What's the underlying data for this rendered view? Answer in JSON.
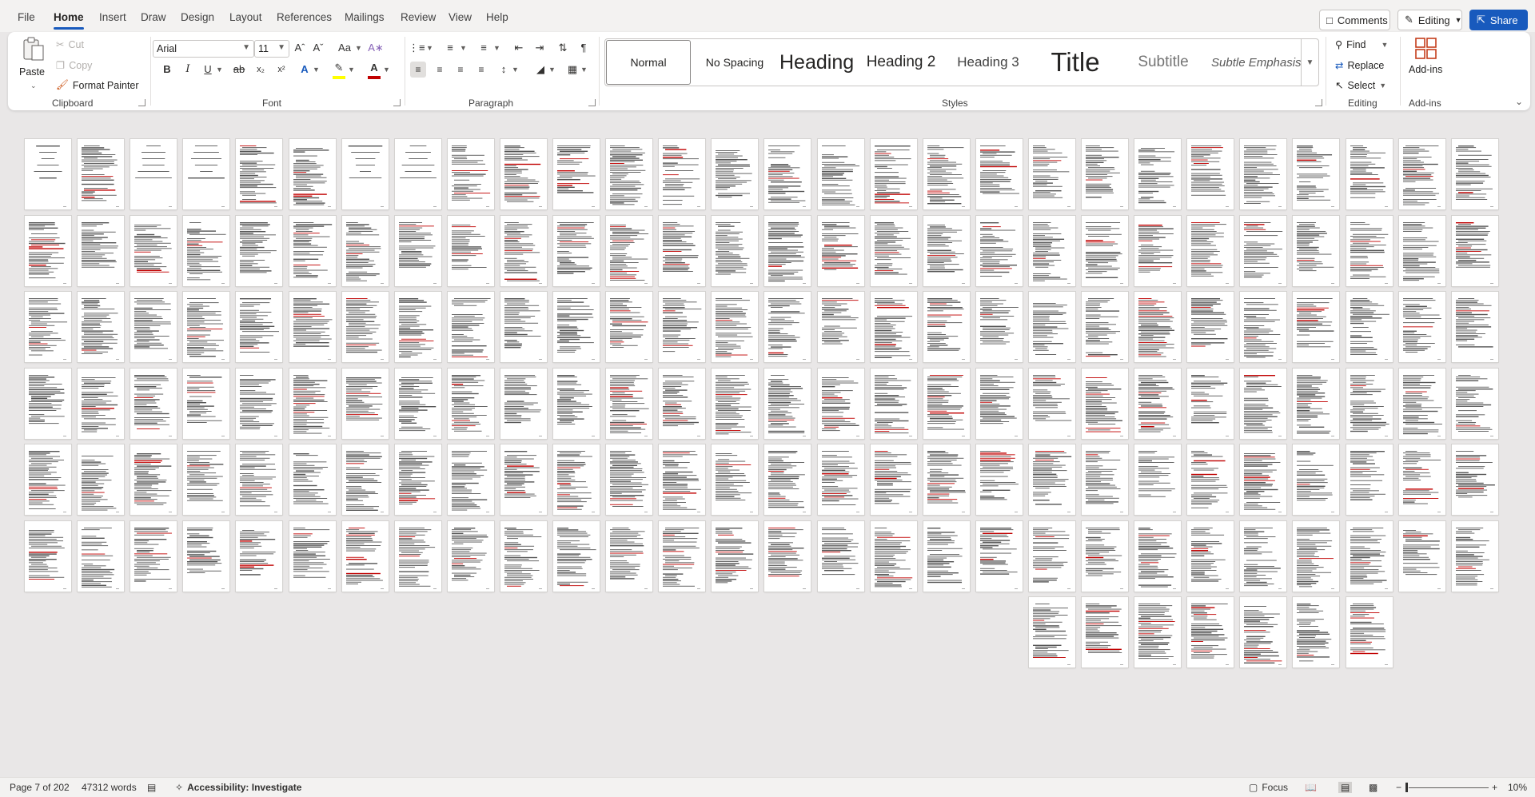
{
  "menu": {
    "tabs": [
      "File",
      "Home",
      "Insert",
      "Draw",
      "Design",
      "Layout",
      "References",
      "Mailings",
      "Review",
      "View",
      "Help"
    ],
    "active_tab": "Home",
    "comments_label": "Comments",
    "editing_label": "Editing",
    "share_label": "Share"
  },
  "ribbon": {
    "clipboard": {
      "paste_label": "Paste",
      "cut_label": "Cut",
      "copy_label": "Copy",
      "format_painter_label": "Format Painter",
      "group_label": "Clipboard"
    },
    "font": {
      "font_name": "Arial",
      "font_size": "11",
      "group_label": "Font",
      "highlight_color": "#ffff00",
      "font_color": "#c00000"
    },
    "paragraph": {
      "group_label": "Paragraph"
    },
    "styles": {
      "group_label": "Styles",
      "items": [
        "Normal",
        "No Spacing",
        "Heading 1",
        "Heading 2",
        "Heading 3",
        "Title",
        "Subtitle",
        "Subtle Emphasis"
      ],
      "selected": "Normal"
    },
    "editing": {
      "find_label": "Find",
      "replace_label": "Replace",
      "select_label": "Select",
      "group_label": "Editing"
    },
    "addins": {
      "addins_label": "Add-ins",
      "group_label": "Add-ins"
    }
  },
  "document": {
    "total_pages": 202,
    "visible_thumbnails": 175,
    "zoom_percent": 10,
    "pages_per_row": 28
  },
  "status": {
    "page_info": "Page 7 of 202",
    "word_count": "47312 words",
    "accessibility": "Accessibility: Investigate",
    "focus_label": "Focus",
    "zoom": "10%"
  },
  "colors": {
    "accent": "#185abd",
    "background": "#e9e7e7",
    "ribbon": "#ffffff",
    "text_markup": "#c00000"
  }
}
